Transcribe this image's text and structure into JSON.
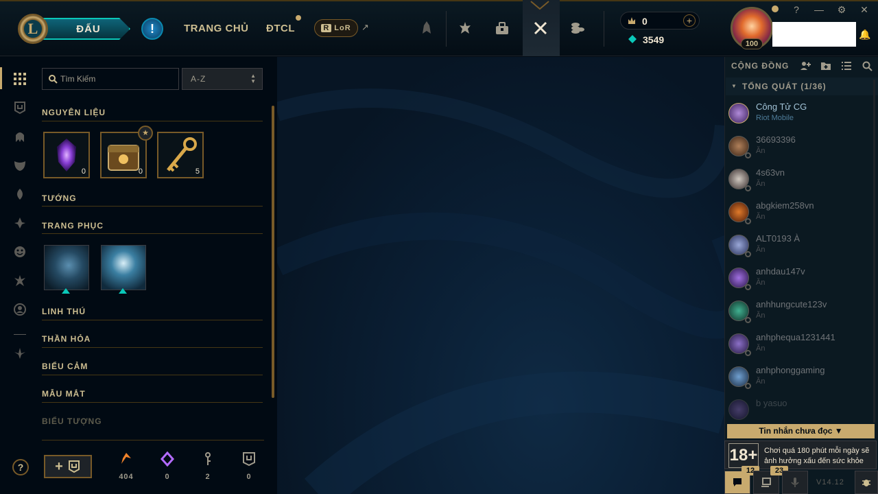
{
  "header": {
    "play_label": "ĐẤU",
    "alert_glyph": "!",
    "nav": [
      {
        "label": "TRANG CHỦ"
      },
      {
        "label": "ĐTCL"
      }
    ],
    "lor_label": "LoR",
    "lor_logo_letter": "R",
    "external_arrow": "↗",
    "rp_value": "0",
    "be_value": "3549",
    "level": "100",
    "window_controls": {
      "help": "?",
      "minimize": "—",
      "settings": "⚙",
      "close": "✕"
    },
    "colors": {
      "gold": "#c8aa6e",
      "teal": "#0ac8b9",
      "background": "#010a13"
    }
  },
  "collection": {
    "search_placeholder": "Tìm Kiếm",
    "sort_value": "A-Z",
    "sections": {
      "materials": "NGUYÊN LIỆU",
      "champions": "TƯỚNG",
      "skins": "TRANG PHỤC",
      "wards": "LINH THÚ",
      "emotes": "THẦN HỎA",
      "icons": "BIỂU CẢM",
      "chromas": "MẪU MẮT",
      "summoner_icons": "BIỂU TƯỢNG"
    },
    "materials": [
      {
        "name": "essence-icon",
        "count": "0"
      },
      {
        "name": "chest-icon",
        "count": "0"
      },
      {
        "name": "key-icon",
        "count": "5"
      }
    ],
    "footer_stats": [
      {
        "icon": "orange-essence-icon",
        "value": "404"
      },
      {
        "icon": "mythic-essence-icon",
        "value": "0"
      },
      {
        "icon": "key-fragment-icon",
        "value": "2"
      },
      {
        "icon": "collection-icon",
        "value": "0"
      }
    ],
    "add_label": "+"
  },
  "social": {
    "title": "CỘNG ĐỒNG",
    "group_label": "TỔNG QUÁT (1/36)",
    "friends": [
      {
        "name": "Công Tử CG",
        "status": "Riot Mobile",
        "online": true
      },
      {
        "name": "36693396",
        "status": "Ăn",
        "online": false
      },
      {
        "name": "4s63vn",
        "status": "Ăn",
        "online": false
      },
      {
        "name": "abgkiem258vn",
        "status": "Ăn",
        "online": false
      },
      {
        "name": "ALT0193 À",
        "status": "Ăn",
        "online": false
      },
      {
        "name": "anhdau147v",
        "status": "Ăn",
        "online": false
      },
      {
        "name": "anhhungcute123v",
        "status": "Ăn",
        "online": false
      },
      {
        "name": "anhphequa1231441",
        "status": "Ăn",
        "online": false
      },
      {
        "name": "anhphonggaming",
        "status": "Ăn",
        "online": false
      },
      {
        "name": "b yasuo",
        "status": "",
        "online": false
      }
    ],
    "unread_label": "Tin nhắn chưa đọc ▼",
    "age_rating": "18+",
    "age_warning": "Chơi quá 180 phút mỗi ngày sẽ ảnh hưởng xấu đến sức khỏe",
    "chat_badge": "12",
    "messages_badge": "23",
    "version": "V14.12"
  }
}
